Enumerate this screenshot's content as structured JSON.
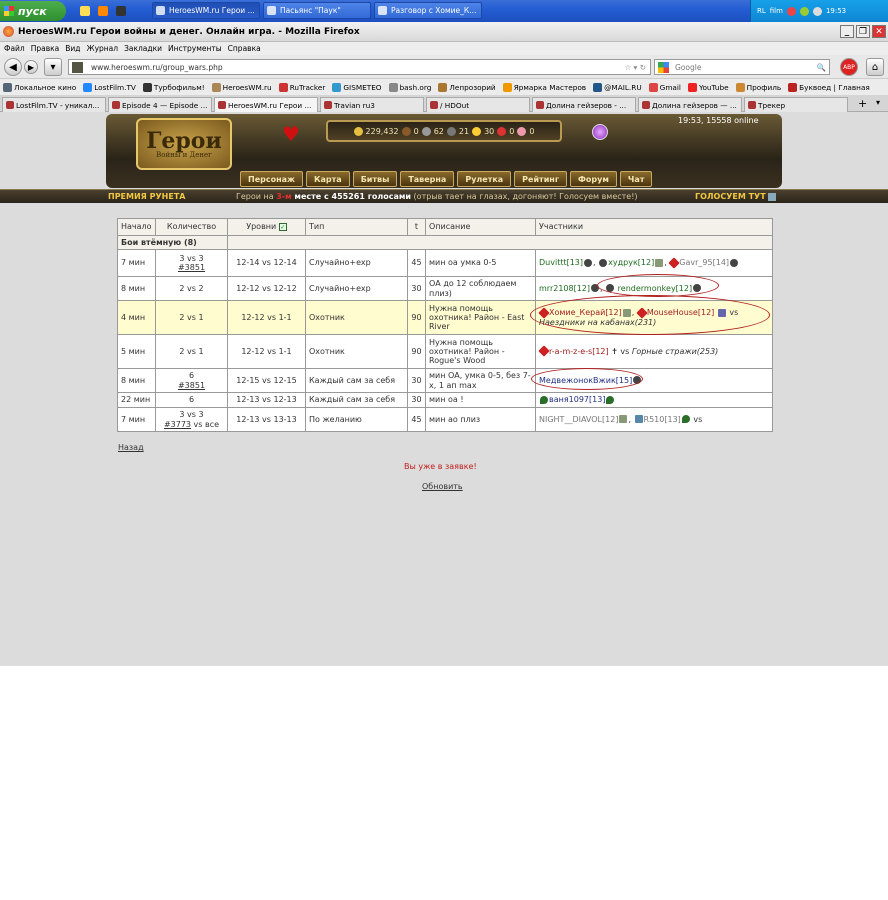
{
  "taskbar": {
    "start": "пуск",
    "windows": [
      "HeroesWM.ru Герои ...",
      "Пасьянс \"Паук\"",
      "Разговор с Хомие_К..."
    ],
    "tray": [
      "RL",
      "film"
    ],
    "clock": "19:53"
  },
  "window": {
    "title": "HeroesWM.ru Герои войны и денег. Онлайн игра. - Mozilla Firefox"
  },
  "menu": [
    "Файл",
    "Правка",
    "Вид",
    "Журнал",
    "Закладки",
    "Инструменты",
    "Справка"
  ],
  "nav": {
    "url": "www.heroeswm.ru/group_wars.php",
    "search_placeholder": "Google"
  },
  "bookmarks": [
    "Локальное кино",
    "LostFilm.TV",
    "Турбофильм!",
    "HeroesWM.ru",
    "RuTracker",
    "GISMETEO",
    "bash.org",
    "Лепрозорий",
    "Ярмарка Мастеров",
    "@MAIL.RU",
    "Gmail",
    "YouTube",
    "Профиль",
    "Буквоед | Главная"
  ],
  "tabs": [
    "LostFilm.TV - уникал...",
    "Episode 4 — Episode ...",
    "HeroesWM.ru Герои ...",
    "Travian ru3",
    "/ HDOut",
    "Долина гейзеров - ...",
    "Долина гейзеров — ...",
    "Трекер"
  ],
  "game": {
    "logo": "Герои",
    "logo_sub": "Войны и Денег",
    "resources": [
      "229,432",
      "0",
      "62",
      "21",
      "30",
      "0",
      "0"
    ],
    "online": "19:53, 15558 online",
    "nav": [
      "Персонаж",
      "Карта",
      "Битвы",
      "Таверна",
      "Рулетка",
      "Рейтинг",
      "Форум",
      "Чат"
    ]
  },
  "premium": {
    "left": "ПРЕМИЯ РУНЕТА",
    "mid_a": "Герои на ",
    "mid_place": "3-м",
    "mid_b": " месте с 455261 голосами",
    "mid_c": " (отрыв тает на глазах, догоняют! Голосуем вместе!)",
    "right": "ГОЛОСУЕМ ТУТ"
  },
  "table": {
    "headers": [
      "Начало",
      "Количество",
      "Уровни",
      "Тип",
      "t",
      "Описание",
      "Участники"
    ],
    "group": "Бои втёмную (8)",
    "rows": [
      {
        "start": "7 мин",
        "count": "3 vs 3",
        "count_link": "#3851",
        "levels": "12-14 vs 12-14",
        "type": "Случайно+exp",
        "t": "45",
        "desc": "мин оа умка 0-5",
        "players": [
          "Duvittt[13]",
          "худрук[12]",
          "Gavr_95[14]"
        ]
      },
      {
        "start": "8 мин",
        "count": "2 vs 2",
        "count_link": "",
        "levels": "12-12 vs 12-12",
        "type": "Случайно+exp",
        "t": "30",
        "desc": "ОА до 12 соблюдаем плиз)",
        "players": [
          "mrr2108[12]",
          "rendermonkey[12]"
        ]
      },
      {
        "start": "4 мин",
        "count": "2 vs 1",
        "count_link": "",
        "levels": "12-12 vs 1-1",
        "type": "Охотник",
        "t": "90",
        "desc": "Нужна помощь охотника! Район - East River",
        "players": [
          "Хомие_Керай[12]",
          "MouseHouse[12]"
        ],
        "vs": "vs",
        "enemy": "Наездники на кабанах(231)"
      },
      {
        "start": "5 мин",
        "count": "2 vs 1",
        "count_link": "",
        "levels": "12-12 vs 1-1",
        "type": "Охотник",
        "t": "90",
        "desc": "Нужна помощь охотника! Район - Rogue's Wood",
        "players": [
          "r-a-m-z-e-s[12]"
        ],
        "vs": "vs",
        "enemy": "Горные стражи(253)"
      },
      {
        "start": "8 мин",
        "count": "6",
        "count_link": "#3851",
        "levels": "12-15 vs 12-15",
        "type": "Каждый сам за себя",
        "t": "30",
        "desc": "мин ОА, умка 0-5, без 7-х, 1 ап max",
        "players": [
          "МедвежонокВжик[15]"
        ]
      },
      {
        "start": "22 мин",
        "count": "6",
        "count_link": "",
        "levels": "12-13 vs 12-13",
        "type": "Каждый сам за себя",
        "t": "30",
        "desc": "мин оа !",
        "players": [
          "ваня1097[13]"
        ]
      },
      {
        "start": "7 мин",
        "count": "3 vs 3",
        "count_link": "#3773",
        "count_suffix": " vs все",
        "levels": "12-13 vs 13-13",
        "type": "По желанию",
        "t": "45",
        "desc": "мин ао плиз",
        "players": [
          "NIGHT__DIAVOL[12]",
          "R510[13]"
        ],
        "vs": "vs"
      }
    ]
  },
  "footer": {
    "back": "Назад",
    "already": "Вы уже в заявке!",
    "refresh": "Обновить"
  }
}
